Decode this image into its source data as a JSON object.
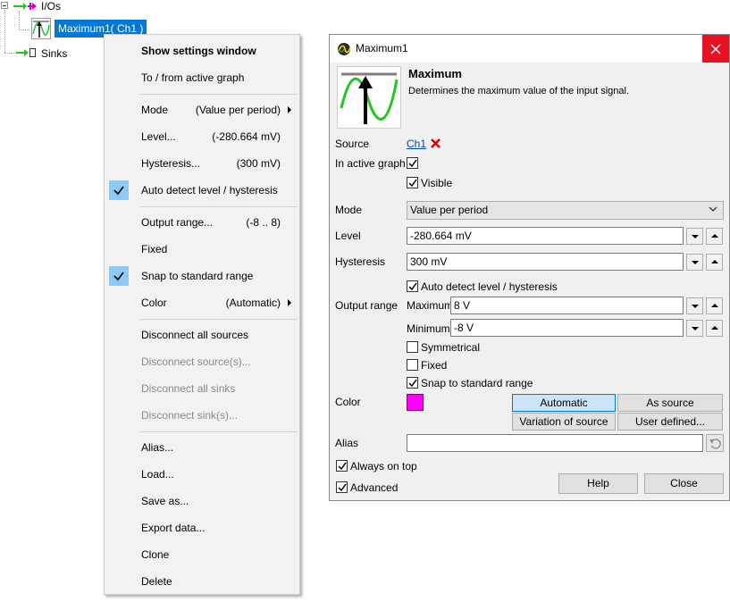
{
  "tree": {
    "root_label": "I/Os",
    "selected_label": "Maximum1( Ch1 )",
    "sinks_label": "Sinks"
  },
  "menu": {
    "show_settings": "Show settings window",
    "to_from_graph": "To / from active graph",
    "mode_label": "Mode",
    "mode_value": "(Value per period)",
    "level_label": "Level...",
    "level_value": "(-280.664 mV)",
    "hysteresis_label": "Hysteresis...",
    "hysteresis_value": "(300 mV)",
    "auto_detect": "Auto detect level / hysteresis",
    "output_range_label": "Output range...",
    "output_range_value": "(-8 .. 8)",
    "fixed": "Fixed",
    "snap": "Snap to standard range",
    "color_label": "Color",
    "color_value": "(Automatic)",
    "disconnect_all_sources": "Disconnect all sources",
    "disconnect_sources": "Disconnect source(s)...",
    "disconnect_all_sinks": "Disconnect all sinks",
    "disconnect_sinks": "Disconnect sink(s)...",
    "alias": "Alias...",
    "load": "Load...",
    "save_as": "Save as...",
    "export_data": "Export data...",
    "clone": "Clone",
    "delete": "Delete"
  },
  "dialog": {
    "title": "Maximum1",
    "heading": "Maximum",
    "description": "Determines the maximum value of the input signal.",
    "source_label": "Source",
    "source_link": "Ch1",
    "in_active_graph_label": "In active graph",
    "visible_label": "Visible",
    "mode_label": "Mode",
    "mode_value": "Value per period",
    "level_label": "Level",
    "level_value": "-280.664 mV",
    "hysteresis_label": "Hysteresis",
    "hysteresis_value": "300 mV",
    "auto_detect_label": "Auto detect level / hysteresis",
    "output_range_label": "Output range",
    "maximum_label": "Maximum",
    "maximum_value": "8 V",
    "minimum_label": "Minimum",
    "minimum_value": "-8 V",
    "symmetrical_label": "Symmetrical",
    "fixed_label": "Fixed",
    "snap_label": "Snap to standard range",
    "color_label": "Color",
    "color_swatch": "#ff00ff",
    "btn_automatic": "Automatic",
    "btn_as_source": "As source",
    "btn_variation": "Variation of source",
    "btn_user_defined": "User defined...",
    "alias_label": "Alias",
    "alias_value": "",
    "always_on_top_label": "Always on top",
    "advanced_label": "Advanced",
    "help_button": "Help",
    "close_button": "Close"
  },
  "colors": {
    "selection": "#0078d7",
    "menu_check": "#90c8f6",
    "close_red": "#e81123",
    "signal_green": "#1ec81e"
  }
}
